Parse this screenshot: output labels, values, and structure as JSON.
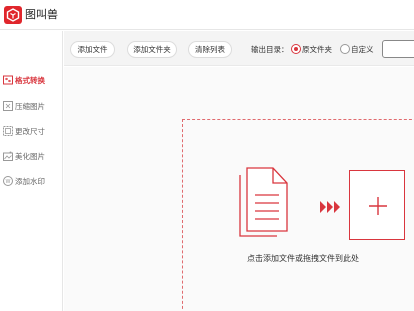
{
  "app": {
    "title": "图叫兽",
    "accent": "#d9363e"
  },
  "sidebar": {
    "items": [
      {
        "label": "格式转换",
        "icon": "format-convert-icon",
        "active": true
      },
      {
        "label": "压缩图片",
        "icon": "compress-image-icon",
        "active": false
      },
      {
        "label": "更改尺寸",
        "icon": "resize-icon",
        "active": false
      },
      {
        "label": "美化图片",
        "icon": "beautify-icon",
        "active": false
      },
      {
        "label": "添加水印",
        "icon": "watermark-icon",
        "active": false
      }
    ]
  },
  "toolbar": {
    "add_file": "添加文件",
    "add_folder": "添加文件夹",
    "clear_list": "清除列表",
    "output_dir_label": "输出目录：",
    "output_options": [
      {
        "label": "原文件夹",
        "checked": true
      },
      {
        "label": "自定义",
        "checked": false
      }
    ],
    "path_value": ""
  },
  "dropzone": {
    "hint": "点击添加文件或拖拽文件到此处",
    "icons": [
      "document-icon",
      "triple-arrow-icon",
      "plus-icon"
    ]
  }
}
